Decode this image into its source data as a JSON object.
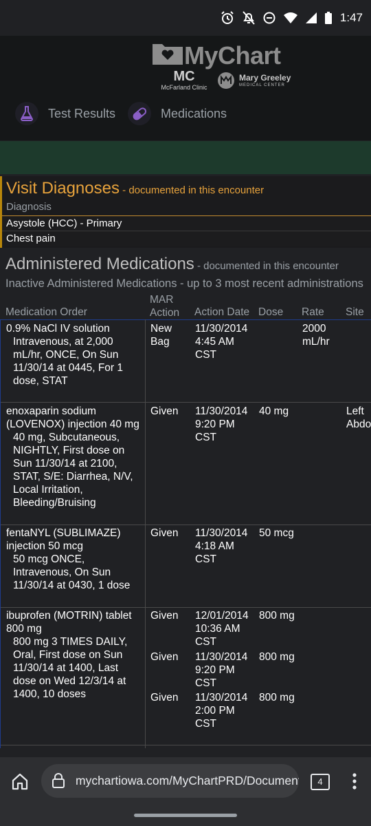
{
  "status_bar": {
    "time": "1:47"
  },
  "header": {
    "app_name": "MyChart",
    "clinic_name": "McFarland Clinic",
    "clinic_initials": "MC",
    "center_name": "Mary Greeley",
    "center_sub": "MEDICAL CENTER",
    "nav": [
      {
        "label": "Test Results"
      },
      {
        "label": "Medications"
      }
    ]
  },
  "visit_diagnoses": {
    "title": "Visit Diagnoses",
    "subtitle": " - documented in this encounter",
    "column_header": "Diagnosis",
    "rows": [
      "Asystole (HCC) - Primary",
      "Chest pain"
    ]
  },
  "administered": {
    "title": "Administered Medications",
    "subtitle": " - documented in this encounter",
    "inactive_line": "Inactive Administered Medications - up to 3 most recent administrations",
    "columns": {
      "order": "Medication Order",
      "mar_action_line1": "MAR",
      "mar_action_line2": "Action",
      "action_date": "Action Date",
      "dose": "Dose",
      "rate": "Rate",
      "site": "Site"
    },
    "rows": [
      {
        "name": "0.9% NaCl IV solution",
        "detail": "Intravenous, at 2,000 mL/hr, ONCE, On Sun 11/30/14 at 0445, For 1 dose, STAT",
        "admins": [
          {
            "action": "New Bag",
            "date": "11/30/2014 4:45 AM CST",
            "dose": "",
            "rate": "2000 mL/hr",
            "site": ""
          }
        ]
      },
      {
        "name": "enoxaparin sodium (LOVENOX) injection 40 mg",
        "detail": "40 mg, Subcutaneous, NIGHTLY, First dose on Sun 11/30/14 at 2100, STAT, S/E: Diarrhea, N/V, Local Irritation, Bleeding/Bruising",
        "admins": [
          {
            "action": "Given",
            "date": "11/30/2014 9:20 PM CST",
            "dose": "40 mg",
            "rate": "",
            "site": "Left Abdo"
          }
        ]
      },
      {
        "name": "fentaNYL (SUBLIMAZE) injection 50 mcg",
        "detail": "50 mcg ONCE, Intravenous, On Sun 11/30/14 at 0430, 1 dose",
        "admins": [
          {
            "action": "Given",
            "date": "11/30/2014 4:18 AM CST",
            "dose": "50 mcg",
            "rate": "",
            "site": ""
          }
        ]
      },
      {
        "name": "ibuprofen (MOTRIN) tablet 800 mg",
        "detail": "800 mg 3 TIMES DAILY, Oral, First dose on Sun 11/30/14 at 1400, Last dose on Wed 12/3/14 at 1400, 10 doses",
        "admins": [
          {
            "action": "Given",
            "date": "12/01/2014 10:36 AM CST",
            "dose": "800 mg",
            "rate": "",
            "site": ""
          },
          {
            "action": "Given",
            "date": "11/30/2014 9:20 PM CST",
            "dose": "800 mg",
            "rate": "",
            "site": ""
          },
          {
            "action": "Given",
            "date": "11/30/2014 2:00 PM CST",
            "dose": "800 mg",
            "rate": "",
            "site": ""
          }
        ]
      }
    ]
  },
  "browser": {
    "url": "mychartiowa.com/MyChartPRD/Document",
    "tab_count": "4"
  },
  "icons": {
    "alarm": "alarm-icon",
    "notifications_off": "notifications-off-icon",
    "dnd": "do-not-disturb-icon",
    "wifi": "wifi-icon",
    "signal": "signal-icon",
    "battery": "battery-icon",
    "home": "home-icon",
    "lock": "lock-icon",
    "menu": "more-vert-icon"
  },
  "colors": {
    "diagnoses_accent": "#e8a33c",
    "green_band": "#1d3a2c",
    "table_left_border": "#1f3c8c"
  }
}
